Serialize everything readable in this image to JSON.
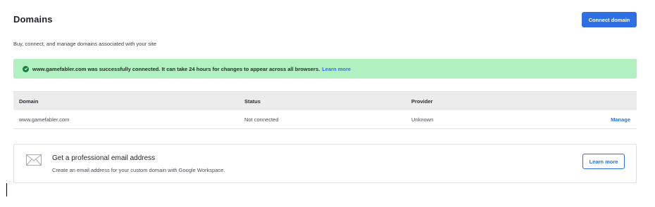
{
  "header": {
    "title": "Domains",
    "connect_label": "Connect domain",
    "subtitle": "Buy, connect, and manage domains associated with your site"
  },
  "banner": {
    "icon": "check-circle-icon",
    "message": "www.gamefabler.com was successfully connected. It can take 24 hours for changes to appear across all browsers.",
    "link_label": "Learn more",
    "color": "#b1f0c0"
  },
  "table": {
    "columns": [
      "Domain",
      "Status",
      "Provider"
    ],
    "rows": [
      {
        "domain": "www.gamefabler.com",
        "status": "Not connected",
        "provider": "Unknown",
        "action": "Manage"
      }
    ]
  },
  "email_card": {
    "icon": "envelope-icon",
    "title": "Get a professional email address",
    "description": "Create an email address for your custom domain with Google Workspace.",
    "button_label": "Learn more"
  },
  "colors": {
    "accent": "#2f6fe4",
    "success_bg": "#b1f0c0",
    "success_icon": "#15803d"
  }
}
